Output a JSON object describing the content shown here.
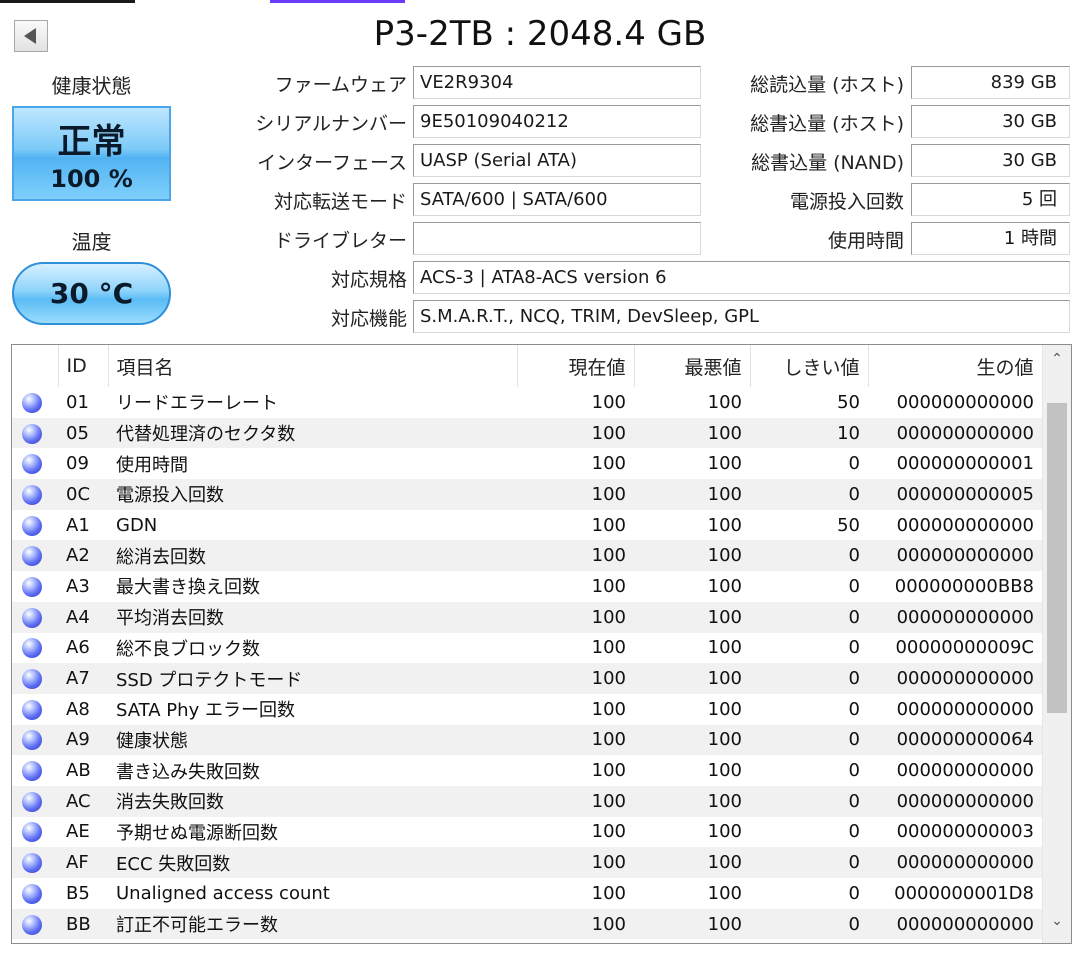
{
  "title": "P3-2TB : 2048.4 GB",
  "health": {
    "label": "健康状態",
    "status": "正常",
    "percent": "100 %"
  },
  "temperature": {
    "label": "温度",
    "value": "30 °C"
  },
  "info_left": [
    {
      "label": "ファームウェア",
      "value": "VE2R9304"
    },
    {
      "label": "シリアルナンバー",
      "value": "9E50109040212"
    },
    {
      "label": "インターフェース",
      "value": "UASP (Serial ATA)"
    },
    {
      "label": "対応転送モード",
      "value": "SATA/600 | SATA/600"
    },
    {
      "label": "ドライブレター",
      "value": ""
    }
  ],
  "info_right": [
    {
      "label": "総読込量 (ホスト)",
      "value": "839 GB"
    },
    {
      "label": "総書込量 (ホスト)",
      "value": "30 GB"
    },
    {
      "label": "総書込量 (NAND)",
      "value": "30 GB"
    },
    {
      "label": "電源投入回数",
      "value": "5 回"
    },
    {
      "label": "使用時間",
      "value": "1 時間"
    }
  ],
  "standard": {
    "label": "対応規格",
    "value": "ACS-3 | ATA8-ACS version 6"
  },
  "features": {
    "label": "対応機能",
    "value": "S.M.A.R.T., NCQ, TRIM, DevSleep, GPL"
  },
  "table": {
    "headers": {
      "id": "ID",
      "name": "項目名",
      "current": "現在値",
      "worst": "最悪値",
      "threshold": "しきい値",
      "raw": "生の値"
    },
    "rows": [
      {
        "id": "01",
        "name": "リードエラーレート",
        "current": "100",
        "worst": "100",
        "threshold": "50",
        "raw": "000000000000"
      },
      {
        "id": "05",
        "name": "代替処理済のセクタ数",
        "current": "100",
        "worst": "100",
        "threshold": "10",
        "raw": "000000000000"
      },
      {
        "id": "09",
        "name": "使用時間",
        "current": "100",
        "worst": "100",
        "threshold": "0",
        "raw": "000000000001"
      },
      {
        "id": "0C",
        "name": "電源投入回数",
        "current": "100",
        "worst": "100",
        "threshold": "0",
        "raw": "000000000005"
      },
      {
        "id": "A1",
        "name": "GDN",
        "current": "100",
        "worst": "100",
        "threshold": "50",
        "raw": "000000000000"
      },
      {
        "id": "A2",
        "name": "総消去回数",
        "current": "100",
        "worst": "100",
        "threshold": "0",
        "raw": "000000000000"
      },
      {
        "id": "A3",
        "name": "最大書き換え回数",
        "current": "100",
        "worst": "100",
        "threshold": "0",
        "raw": "000000000BB8"
      },
      {
        "id": "A4",
        "name": "平均消去回数",
        "current": "100",
        "worst": "100",
        "threshold": "0",
        "raw": "000000000000"
      },
      {
        "id": "A6",
        "name": "総不良ブロック数",
        "current": "100",
        "worst": "100",
        "threshold": "0",
        "raw": "00000000009C"
      },
      {
        "id": "A7",
        "name": "SSD プロテクトモード",
        "current": "100",
        "worst": "100",
        "threshold": "0",
        "raw": "000000000000"
      },
      {
        "id": "A8",
        "name": "SATA Phy エラー回数",
        "current": "100",
        "worst": "100",
        "threshold": "0",
        "raw": "000000000000"
      },
      {
        "id": "A9",
        "name": "健康状態",
        "current": "100",
        "worst": "100",
        "threshold": "0",
        "raw": "000000000064"
      },
      {
        "id": "AB",
        "name": "書き込み失敗回数",
        "current": "100",
        "worst": "100",
        "threshold": "0",
        "raw": "000000000000"
      },
      {
        "id": "AC",
        "name": "消去失敗回数",
        "current": "100",
        "worst": "100",
        "threshold": "0",
        "raw": "000000000000"
      },
      {
        "id": "AE",
        "name": "予期せぬ電源断回数",
        "current": "100",
        "worst": "100",
        "threshold": "0",
        "raw": "000000000003"
      },
      {
        "id": "AF",
        "name": "ECC 失敗回数",
        "current": "100",
        "worst": "100",
        "threshold": "0",
        "raw": "000000000000"
      },
      {
        "id": "B5",
        "name": "Unaligned access count",
        "current": "100",
        "worst": "100",
        "threshold": "0",
        "raw": "0000000001D8"
      },
      {
        "id": "BB",
        "name": "訂正不可能エラー数",
        "current": "100",
        "worst": "100",
        "threshold": "0",
        "raw": "000000000000"
      }
    ]
  },
  "icons": {
    "back": "triangle-left-icon",
    "status_dot": "blue-orb-icon",
    "scroll_up": "chevron-up-icon",
    "scroll_down": "chevron-down-icon"
  },
  "colors": {
    "health_blue": "#52b3f2",
    "status_dot": "#5d6df2"
  }
}
